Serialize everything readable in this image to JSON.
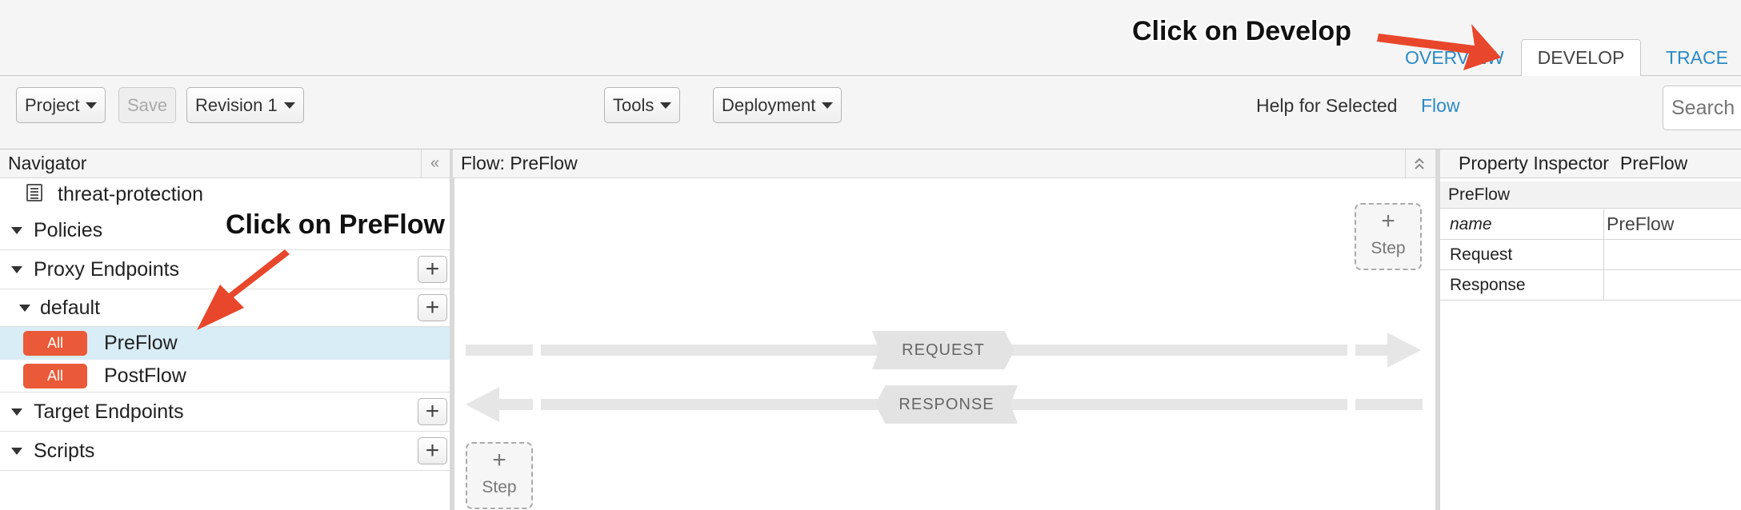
{
  "top_tabs": [
    {
      "label": "OVERVIEW",
      "active": false
    },
    {
      "label": "DEVELOP",
      "active": true
    },
    {
      "label": "TRACE",
      "active": false
    }
  ],
  "toolbar": {
    "project_label": "Project",
    "save_label": "Save",
    "revision_label": "Revision 1",
    "tools_label": "Tools",
    "deployment_label": "Deployment",
    "help_label": "Help for Selected",
    "help_link": "Flow",
    "search_placeholder": "Search"
  },
  "navigator": {
    "title": "Navigator",
    "collapse_icon": "«",
    "proxy_name": "threat-protection",
    "policies_label": "Policies",
    "proxy_endpoints_label": "Proxy Endpoints",
    "default_label": "default",
    "preflow": {
      "badge": "All",
      "label": "PreFlow",
      "selected": true
    },
    "postflow": {
      "badge": "All",
      "label": "PostFlow",
      "selected": false
    },
    "target_endpoints_label": "Target Endpoints",
    "scripts_label": "Scripts",
    "add_icon": "+"
  },
  "flow": {
    "title": "Flow: PreFlow",
    "request_label": "REQUEST",
    "response_label": "RESPONSE",
    "step_plus": "+",
    "step_label": "Step"
  },
  "inspector": {
    "title": "Property Inspector",
    "title_value": "PreFlow",
    "section": "PreFlow",
    "rows": [
      {
        "key": "name",
        "value": "PreFlow"
      },
      {
        "key": "Request",
        "value": ""
      },
      {
        "key": "Response",
        "value": ""
      }
    ]
  },
  "annotations": {
    "develop_callout": "Click on Develop",
    "preflow_callout": "Click on PreFlow",
    "arrow_color": "#e8472c"
  },
  "colors": {
    "accent_link": "#2a8ac7",
    "badge": "#ea5a38",
    "selected_row": "#d9edf7"
  }
}
